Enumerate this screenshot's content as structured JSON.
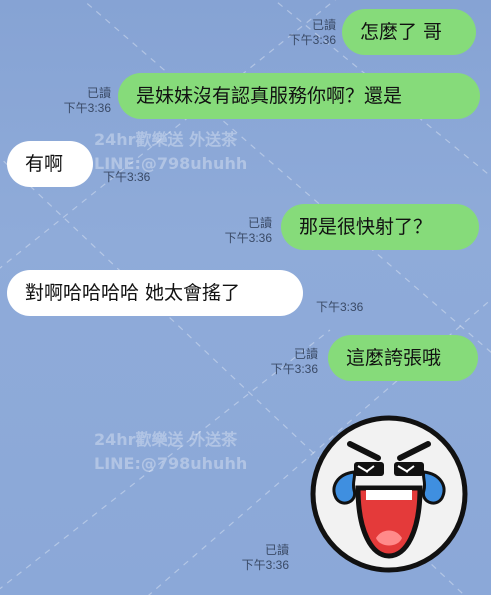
{
  "chat": {
    "messages": [
      {
        "side": "out",
        "text": "怎麼了 哥",
        "read": "已讀",
        "time": "下午3:36"
      },
      {
        "side": "out",
        "text": "是妹妹沒有認真服務你啊？還是",
        "read": "已讀",
        "time": "下午3:36"
      },
      {
        "side": "in",
        "text": "有啊",
        "time": "下午3:36"
      },
      {
        "side": "out",
        "text": "那是很快射了？",
        "read": "已讀",
        "time": "下午3:36"
      },
      {
        "side": "in",
        "text": "對啊哈哈哈哈 她太會搖了",
        "time": "下午3:36"
      },
      {
        "side": "out",
        "text": "這麼誇張哦",
        "read": "已讀",
        "time": "下午3:36"
      },
      {
        "side": "out",
        "type": "sticker",
        "sticker": "crying-laughing-face-sticker",
        "read": "已讀",
        "time": "下午3:36"
      }
    ]
  },
  "watermark": {
    "line1": "24hr歡樂送 外送茶",
    "line2": "LINE:@798uhuhh"
  },
  "colors": {
    "outgoing_bubble": "#86db7a",
    "incoming_bubble": "#ffffff",
    "background": "#8aa7d6"
  }
}
